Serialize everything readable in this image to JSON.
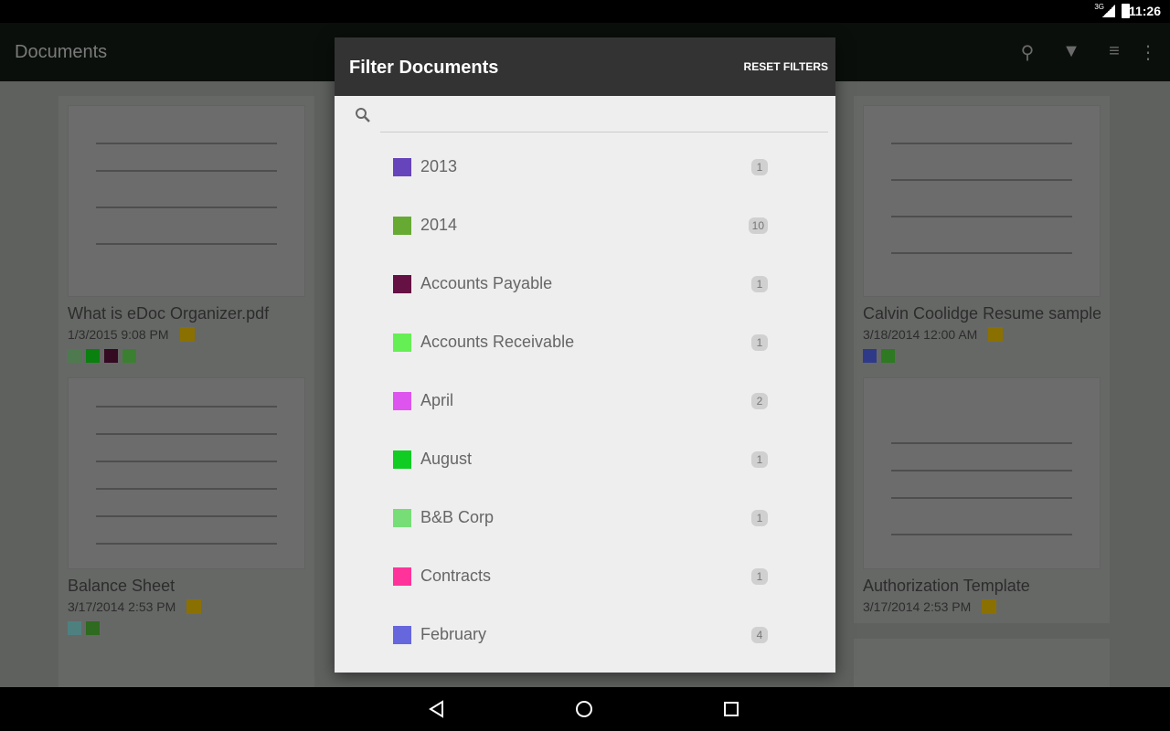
{
  "status": {
    "network": "3G",
    "time": "11:26"
  },
  "appbar": {
    "title": "Documents",
    "icons": [
      "search-icon",
      "filter-icon",
      "sort-icon",
      "more-vert-icon"
    ]
  },
  "cards": [
    {
      "title": "What is eDoc Organizer.pdf",
      "date": "1/3/2015 9:08 PM",
      "tags": [
        "#72b072",
        "#11bb22",
        "#661144",
        "#55bb44"
      ]
    },
    {
      "title": "Calvin Coolidge Resume sample",
      "date": "3/18/2014 12:00 AM",
      "tags": [
        "#4455bb",
        "#44aa33"
      ]
    },
    {
      "title": "Balance Sheet",
      "date": "3/17/2014 2:53 PM",
      "tags": [
        "#77bbbb",
        "#44992f"
      ]
    },
    {
      "title": "Authorization Template",
      "date": "3/17/2014 2:53 PM",
      "tags": []
    }
  ],
  "dialog": {
    "title": "Filter Documents",
    "reset_label": "RESET FILTERS",
    "search_placeholder": "",
    "items": [
      {
        "label": "2013",
        "count": "1",
        "color": "#6644bb"
      },
      {
        "label": "2014",
        "count": "10",
        "color": "#66aa33"
      },
      {
        "label": "Accounts Payable",
        "count": "1",
        "color": "#661144"
      },
      {
        "label": "Accounts Receivable",
        "count": "1",
        "color": "#66ee55"
      },
      {
        "label": "April",
        "count": "2",
        "color": "#dd55ee"
      },
      {
        "label": "August",
        "count": "1",
        "color": "#11cc22"
      },
      {
        "label": "B&B Corp",
        "count": "1",
        "color": "#77dd77"
      },
      {
        "label": "Contracts",
        "count": "1",
        "color": "#ff3399"
      },
      {
        "label": "February",
        "count": "4",
        "color": "#6666dd"
      }
    ]
  }
}
